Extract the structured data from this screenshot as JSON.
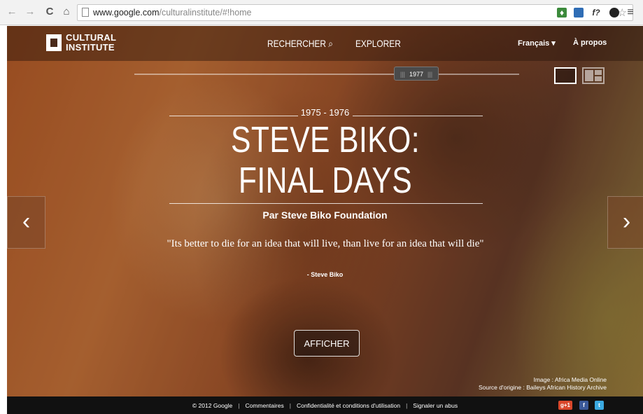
{
  "browser": {
    "url_host": "www.google.com",
    "url_path": "/culturalinstitute/#!home",
    "back_icon": "arrow-left-icon",
    "forward_icon": "arrow-right-icon",
    "reload_glyph": "C",
    "home_glyph": "⌂",
    "star_glyph": "☆",
    "ext_glyph_3": "f?",
    "menu_glyph": "≡"
  },
  "header": {
    "logo_line1": "CULTURAL",
    "logo_line2": "INSTITUTE",
    "nav_search": "RECHERCHER",
    "nav_explore": "EXPLORER",
    "language": "Français ▾",
    "about": "À propos"
  },
  "timeline": {
    "year": "1977"
  },
  "exhibit": {
    "dates": "1975 - 1976",
    "title": "STEVE BIKO: FINAL DAYS",
    "author": "Par Steve Biko Foundation",
    "quote": "\"Its better to die for an idea that will live, than live for an idea that will die\"",
    "quote_by": "- Steve Biko",
    "show_button": "AFFICHER",
    "prev_glyph": "‹",
    "next_glyph": "›"
  },
  "credits": {
    "image": "Image : Africa Media Online",
    "source": "Source d'origine : Baileys African History Archive"
  },
  "footer": {
    "copyright": "© 2012 Google",
    "comments": "Commentaires",
    "privacy": "Confidentialité et conditions d'utilisation",
    "report": "Signaler un abus",
    "gplus_label": "g+1"
  },
  "colors": {
    "footer_bg": "#111111",
    "gplus": "#d9472b",
    "facebook": "#3b5998",
    "twitter": "#3ba9e0"
  }
}
